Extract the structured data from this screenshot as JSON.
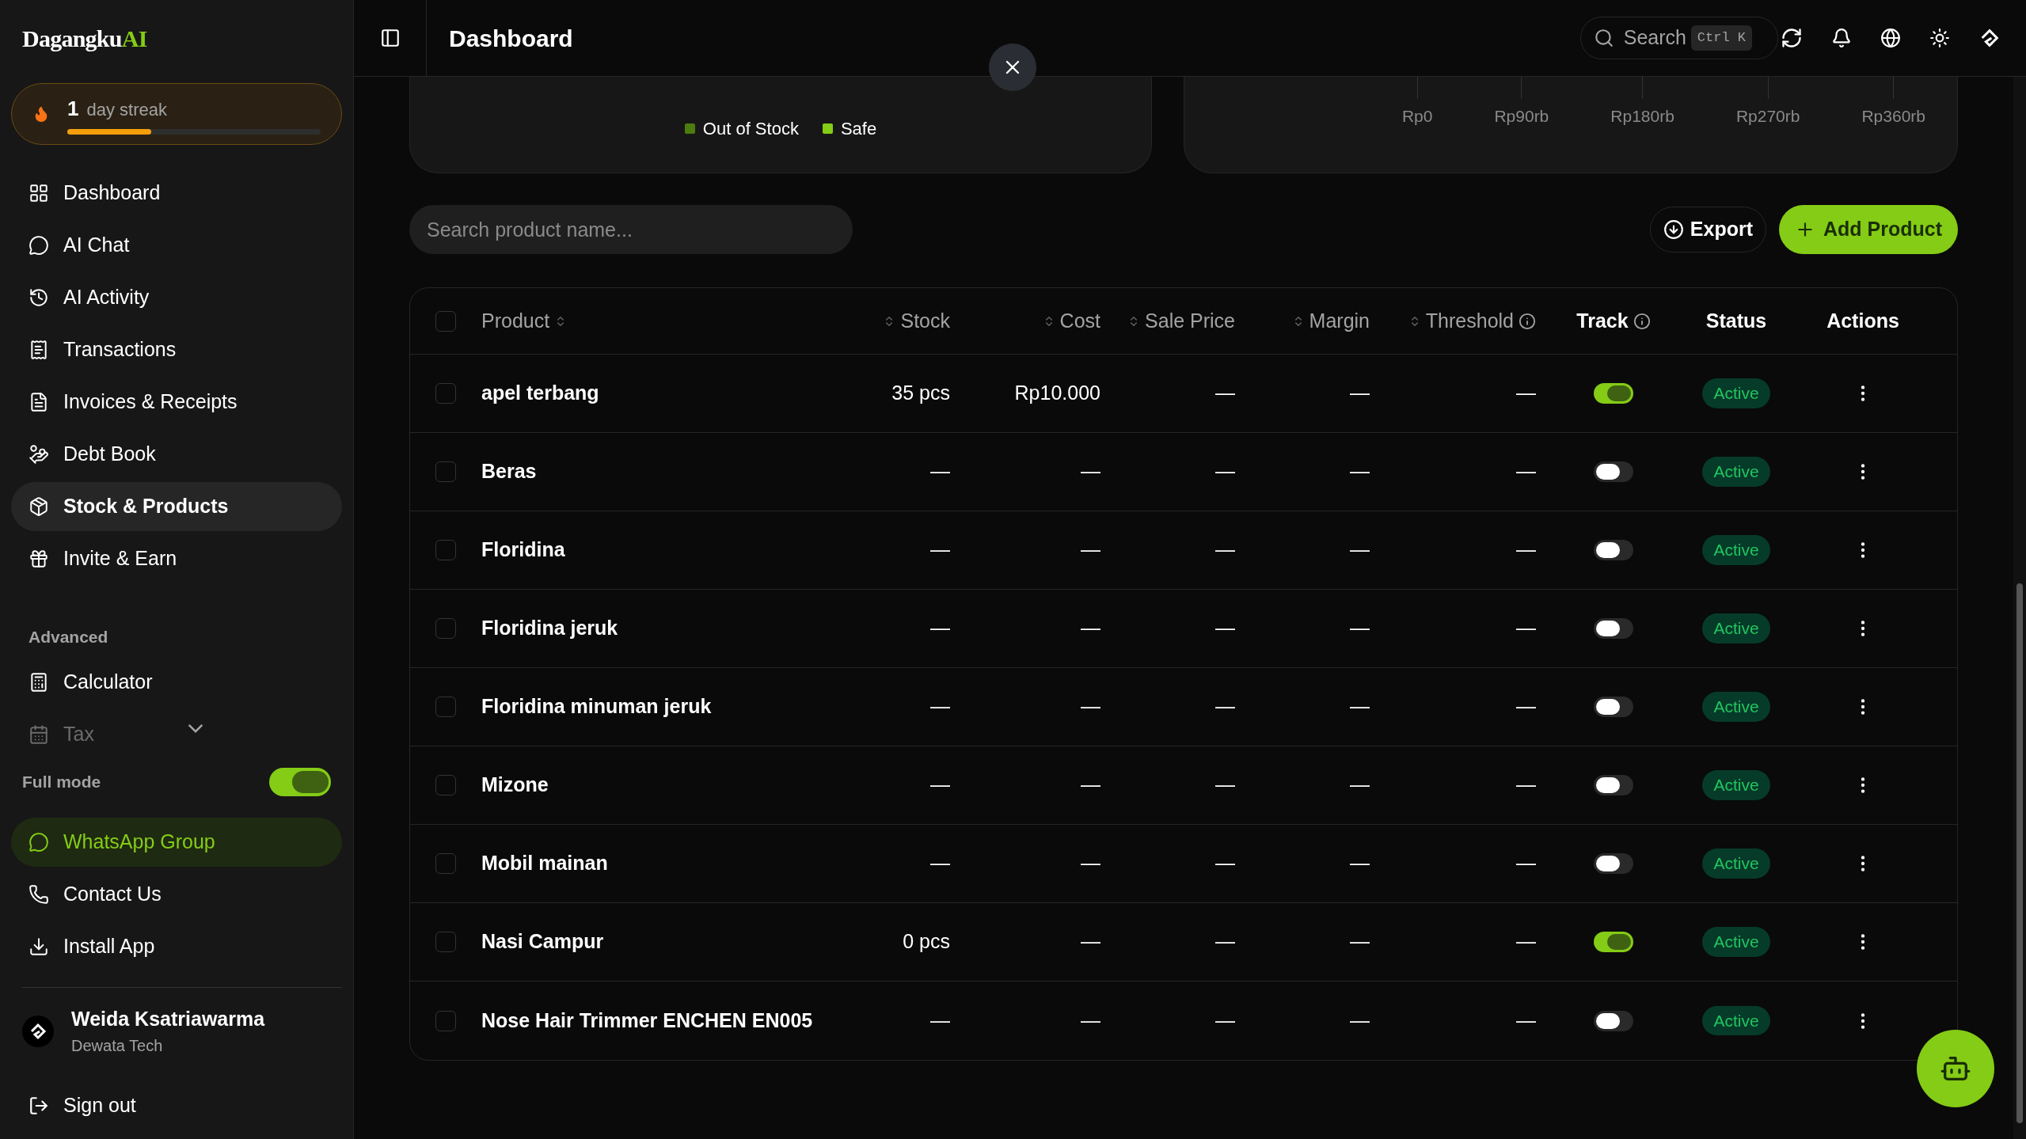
{
  "brand": {
    "name": "Dagangku",
    "accent": "AI"
  },
  "streak": {
    "count": "1",
    "label": "day streak",
    "level": 0.33
  },
  "sidebar": {
    "items": [
      {
        "label": "Dashboard",
        "selected": false
      },
      {
        "label": "AI Chat",
        "selected": false
      },
      {
        "label": "AI Activity",
        "selected": false
      },
      {
        "label": "Transactions",
        "selected": false
      },
      {
        "label": "Invoices & Receipts",
        "selected": false
      },
      {
        "label": "Debt Book",
        "selected": false
      },
      {
        "label": "Stock & Products",
        "selected": true
      },
      {
        "label": "Invite & Earn",
        "selected": false
      }
    ],
    "section": "Advanced",
    "advanced": [
      {
        "label": "Calculator",
        "kind": "link",
        "disabled": false
      },
      {
        "label": "Tax",
        "kind": "dropdown",
        "disabled": true
      }
    ],
    "full_mode": {
      "label": "Full mode",
      "on": true
    },
    "links": [
      {
        "label": "WhatsApp Group",
        "highlighted": true
      },
      {
        "label": "Contact Us",
        "highlighted": false
      },
      {
        "label": "Install App",
        "highlighted": false
      }
    ],
    "user": {
      "name": "Weida Ksatriawarma",
      "company": "Dewata Tech"
    },
    "sign_out": "Sign out"
  },
  "header": {
    "title": "Dashboard",
    "search": "Search",
    "shortcut": "Ctrl K"
  },
  "legend": [
    {
      "label": "Out of Stock",
      "color": "#4d7c0f"
    },
    {
      "label": "Safe",
      "color": "#84cc16"
    }
  ],
  "axis_labels": [
    "Rp0",
    "Rp90rb",
    "Rp180rb",
    "Rp270rb",
    "Rp360rb"
  ],
  "toolbar": {
    "placeholder": "Search product name...",
    "export": "Export",
    "add": "Add Product"
  },
  "table": {
    "select_all_checked": false,
    "columns": [
      {
        "label": "Product",
        "kind": "sort_after"
      },
      {
        "label": "Stock",
        "kind": "sort"
      },
      {
        "label": "Cost",
        "kind": "sort"
      },
      {
        "label": "Sale Price",
        "kind": "sort"
      },
      {
        "label": "Margin",
        "kind": "sort"
      },
      {
        "label": "Threshold",
        "kind": "sort_info"
      },
      {
        "label": "Track",
        "kind": "info"
      },
      {
        "label": "Status",
        "kind": "plain"
      },
      {
        "label": "Actions",
        "kind": "plain"
      }
    ],
    "rows": [
      {
        "product": "apel terbang",
        "stock": "35 pcs",
        "cost": "Rp10.000",
        "sale_price": "—",
        "margin": "—",
        "threshold": "—",
        "track": true,
        "status": "Active",
        "checked": false
      },
      {
        "product": "Beras",
        "stock": "—",
        "cost": "—",
        "sale_price": "—",
        "margin": "—",
        "threshold": "—",
        "track": false,
        "status": "Active",
        "checked": false
      },
      {
        "product": "Floridina",
        "stock": "—",
        "cost": "—",
        "sale_price": "—",
        "margin": "—",
        "threshold": "—",
        "track": false,
        "status": "Active",
        "checked": false
      },
      {
        "product": "Floridina jeruk",
        "stock": "—",
        "cost": "—",
        "sale_price": "—",
        "margin": "—",
        "threshold": "—",
        "track": false,
        "status": "Active",
        "checked": false
      },
      {
        "product": "Floridina minuman jeruk",
        "stock": "—",
        "cost": "—",
        "sale_price": "—",
        "margin": "—",
        "threshold": "—",
        "track": false,
        "status": "Active",
        "checked": false
      },
      {
        "product": "Mizone",
        "stock": "—",
        "cost": "—",
        "sale_price": "—",
        "margin": "—",
        "threshold": "—",
        "track": false,
        "status": "Active",
        "checked": false
      },
      {
        "product": "Mobil mainan",
        "stock": "—",
        "cost": "—",
        "sale_price": "—",
        "margin": "—",
        "threshold": "—",
        "track": false,
        "status": "Active",
        "checked": false
      },
      {
        "product": "Nasi Campur",
        "stock": "0 pcs",
        "cost": "—",
        "sale_price": "—",
        "margin": "—",
        "threshold": "—",
        "track": true,
        "status": "Active",
        "checked": false
      },
      {
        "product": "Nose Hair Trimmer ENCHEN EN005",
        "stock": "—",
        "cost": "—",
        "sale_price": "—",
        "margin": "—",
        "threshold": "—",
        "track": false,
        "status": "Active",
        "checked": false
      }
    ]
  }
}
